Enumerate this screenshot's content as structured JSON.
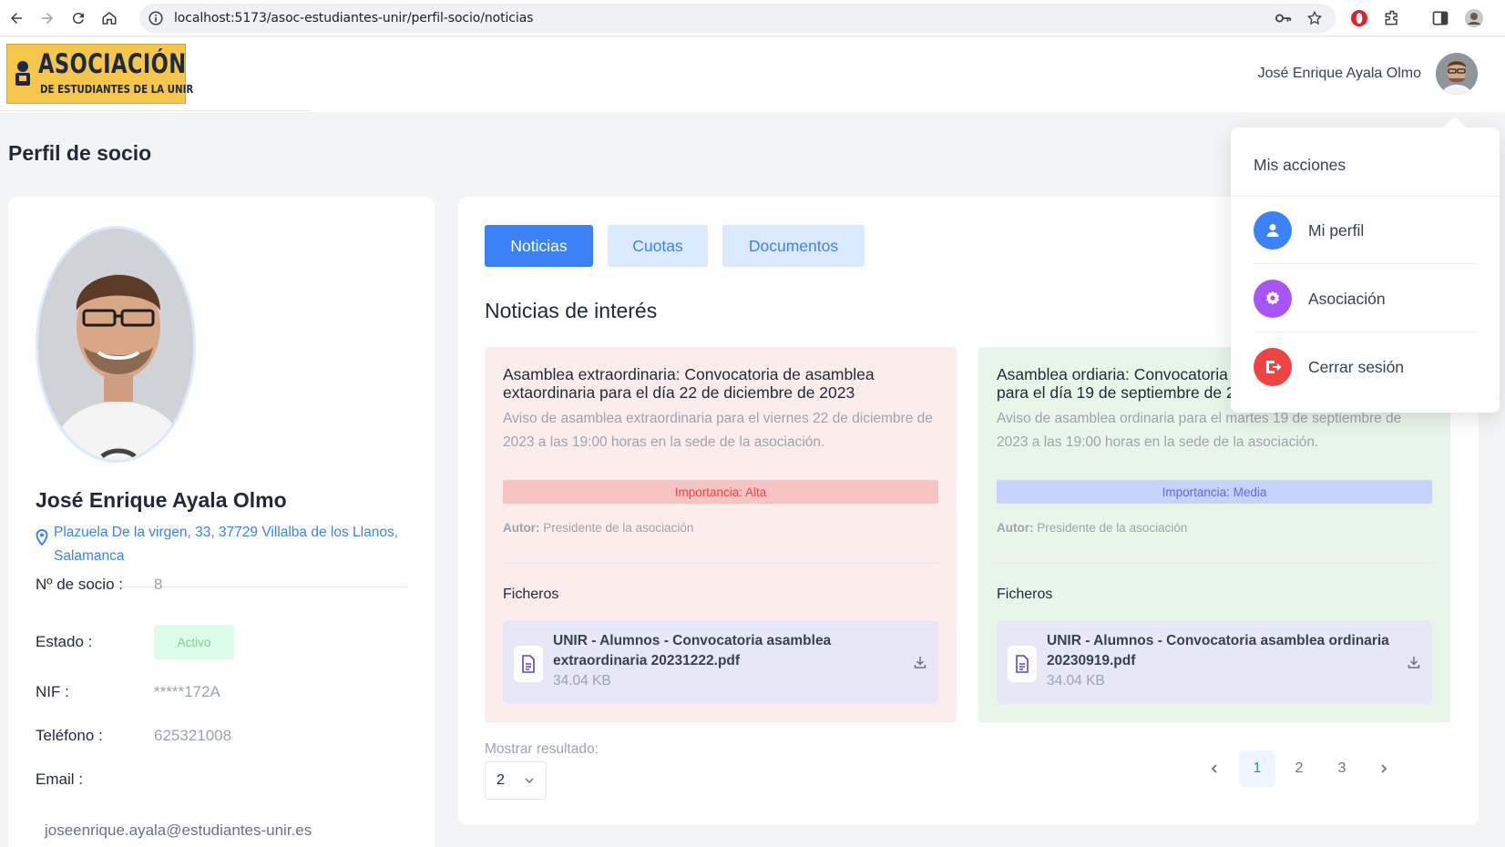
{
  "browser": {
    "url": "localhost:5173/asoc-estudiantes-unir/perfil-socio/noticias"
  },
  "logo": {
    "line1": "ASOCIACIÓN",
    "line2": "DE ESTUDIANTES DE LA UNIR"
  },
  "header": {
    "user_name": "José Enrique Ayala Olmo"
  },
  "page": {
    "title": "Perfil de socio"
  },
  "profile": {
    "name": "José Enrique Ayala Olmo",
    "address": "Plazuela De la virgen, 33, 37729 Villalba de los Llanos, Salamanca",
    "fields": {
      "member_no_label": "Nº de socio :",
      "member_no": "8",
      "status_label": "Estado :",
      "status": "Activo",
      "nif_label": "NIF :",
      "nif": "*****172A",
      "phone_label": "Teléfono :",
      "phone": "625321008",
      "email_label": "Email :",
      "email": "joseenrique.ayala@estudiantes-unir.es"
    }
  },
  "tabs": [
    {
      "label": "Noticias",
      "active": true
    },
    {
      "label": "Cuotas",
      "active": false
    },
    {
      "label": "Documentos",
      "active": false
    }
  ],
  "news": {
    "section_title": "Noticias de interés",
    "items": [
      {
        "title": "Asamblea extraordinaria: Convocatoria de asamblea extaordinaria para el día 22 de diciembre de 2023",
        "description": "Aviso de asamblea extraordinaria para el viernes 22 de diciembre de 2023 a las 19:00 horas en la sede de la asociación.",
        "importance": "Importancia: Alta",
        "author_label": "Autor:",
        "author": " Presidente de la asociación",
        "files_label": "Ficheros",
        "file_name": "UNIR - Alumnos - Convocatoria asamblea extraordinaria 20231222.pdf",
        "file_size": "34.04 KB"
      },
      {
        "title": "Asamblea ordiaria: Convocatoria de asamblea ordinaria para el día 19 de septiembre de 2023",
        "description": "Aviso de asamblea ordinaria para el martes 19 de septiembre de 2023 a las 19:00 horas en la sede de la asociación.",
        "importance": "Importancia: Media",
        "author_label": "Autor:",
        "author": " Presidente de la asociación",
        "files_label": "Ficheros",
        "file_name": "UNIR - Alumnos - Convocatoria asamblea ordinaria 20230919.pdf",
        "file_size": "34.04 KB"
      }
    ]
  },
  "pagination": {
    "show_label": "Mostrar resultado:",
    "page_size": "2",
    "pages": [
      "1",
      "2",
      "3"
    ],
    "current": "1"
  },
  "dropdown": {
    "title": "Mis acciones",
    "items": [
      {
        "label": "Mi perfil",
        "color": "#3b82f6",
        "icon": "user-icon"
      },
      {
        "label": "Asociación",
        "color": "#a855f7",
        "icon": "gear-icon"
      },
      {
        "label": "Cerrar sesión",
        "color": "#ef4444",
        "icon": "logout-icon"
      }
    ]
  },
  "colors": {
    "accent": "#3b82f6",
    "danger": "#ef4444",
    "purple": "#a855f7",
    "logo_bg": "#f5c54c"
  }
}
